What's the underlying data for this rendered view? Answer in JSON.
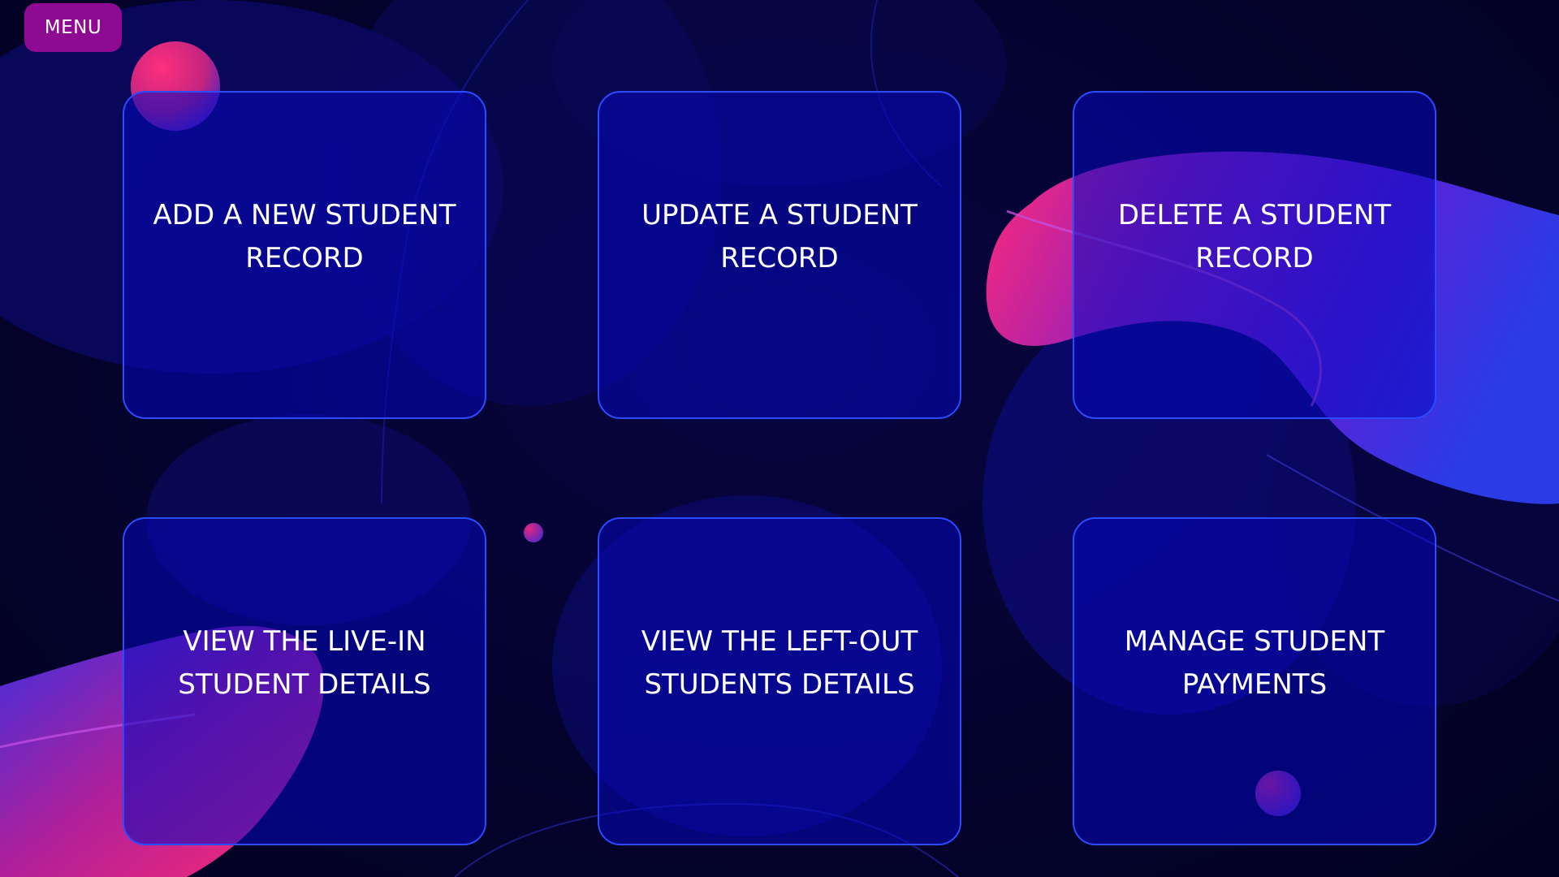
{
  "header": {
    "menu_label": "MENU"
  },
  "cards": [
    {
      "id": "add",
      "label": "ADD A NEW STUDENT\nRECORD"
    },
    {
      "id": "update",
      "label": "UPDATE A STUDENT\nRECORD"
    },
    {
      "id": "delete",
      "label": "DELETE A STUDENT\nRECORD"
    },
    {
      "id": "livein",
      "label": "VIEW THE LIVE-IN\nSTUDENT DETAILS"
    },
    {
      "id": "leftout",
      "label": "VIEW THE LEFT-OUT\nSTUDENTS DETAILS"
    },
    {
      "id": "payments",
      "label": "MANAGE STUDENT\nPAYMENTS"
    }
  ],
  "theme": {
    "background": "#03022a",
    "card_fill": "#0508be",
    "card_border": "#2a4bff",
    "menu_button": "#8e0a92",
    "accent_pink": "#ff2a7a",
    "accent_purple": "#7a1fd6"
  }
}
